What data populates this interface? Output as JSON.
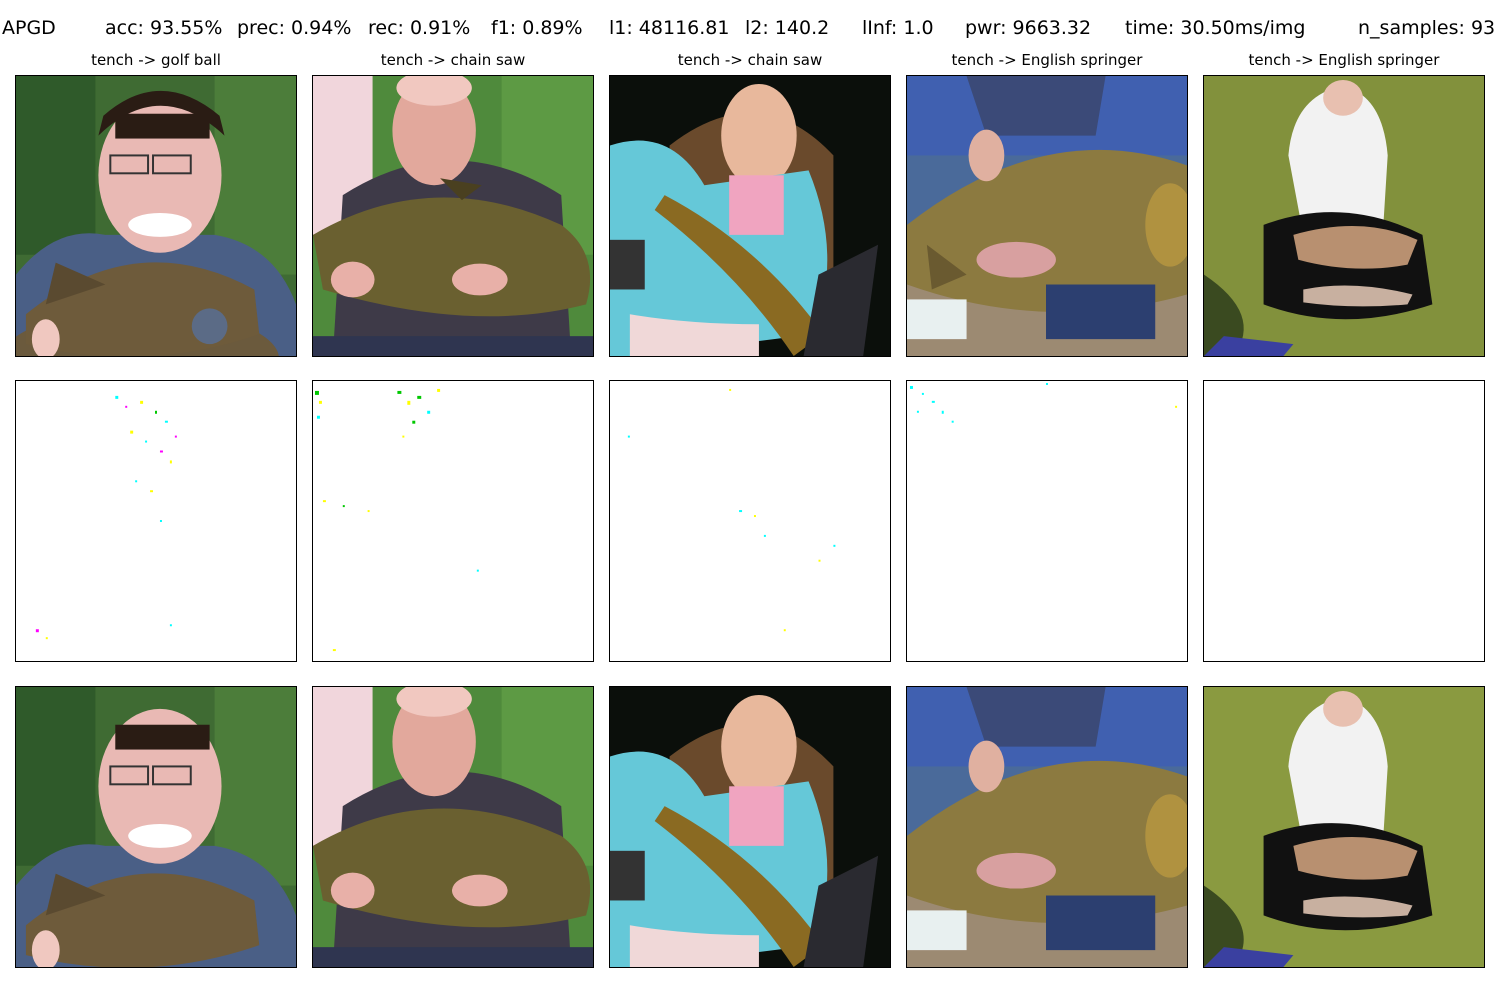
{
  "header": {
    "method": "APGD",
    "acc": "acc: 93.55%",
    "prec": "prec: 0.94%",
    "rec": "rec: 0.91%",
    "f1": "f1: 0.89%",
    "l1": "l1: 48116.81",
    "l2": "l2: 140.2",
    "linf": "lInf: 1.0",
    "pwr": "pwr: 9663.32",
    "time": "time: 30.50ms/img",
    "n_samples": "n_samples: 93"
  },
  "columns": [
    {
      "title": "tench -> golf ball"
    },
    {
      "title": "tench -> chain saw"
    },
    {
      "title": "tench -> chain saw"
    },
    {
      "title": "tench -> English springer"
    },
    {
      "title": "tench -> English springer"
    }
  ],
  "colors": {
    "perturbation_cyan": "#00ffff",
    "perturbation_yellow": "#ffff00",
    "perturbation_magenta": "#ff00ff",
    "perturbation_green": "#00c800"
  }
}
